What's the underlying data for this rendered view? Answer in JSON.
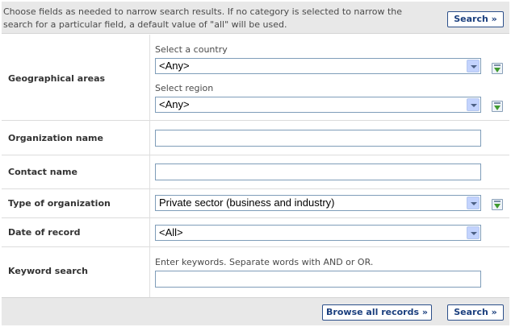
{
  "intro": {
    "line1": "Choose fields as needed to narrow search results. If no category is selected to narrow the",
    "line2": "search for a particular field, a default value of \"all\" will be used."
  },
  "buttons": {
    "search_top": "Search »",
    "browse_all": "Browse all records »",
    "search_bottom": "Search »"
  },
  "geo": {
    "label": "Geographical areas",
    "country_label": "Select a country",
    "country_value": "<Any>",
    "region_label": "Select region",
    "region_value": "<Any>"
  },
  "org_name": {
    "label": "Organization name",
    "value": ""
  },
  "contact_name": {
    "label": "Contact name",
    "value": ""
  },
  "org_type": {
    "label": "Type of organization",
    "value": "Private sector (business and industry)"
  },
  "date": {
    "label": "Date of record",
    "value": "<All>"
  },
  "keyword": {
    "label": "Keyword search",
    "hint": "Enter keywords. Separate words with AND or OR.",
    "value": ""
  },
  "icons": {
    "add": "add-to-list-icon",
    "dropdown": "chevron-down-icon"
  },
  "colors": {
    "bar_bg": "#e8e8e8",
    "button_border": "#2c4f8a",
    "button_text": "#1b3f7e",
    "add_arrow": "#3f9a2f"
  }
}
